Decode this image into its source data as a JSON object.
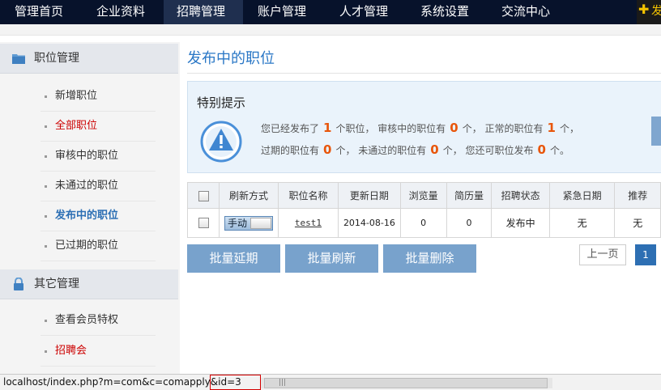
{
  "top_nav": {
    "items": [
      {
        "label": "管理首页",
        "active": false
      },
      {
        "label": "企业资料",
        "active": false
      },
      {
        "label": "招聘管理",
        "active": true
      },
      {
        "label": "账户管理",
        "active": false
      },
      {
        "label": "人才管理",
        "active": false
      },
      {
        "label": "系统设置",
        "active": false
      },
      {
        "label": "交流中心",
        "active": false
      }
    ],
    "publish_label": "发",
    "publish_icon": "plus-icon"
  },
  "sidebar": {
    "groups": [
      {
        "title": "职位管理",
        "icon": "folder-icon",
        "items": [
          {
            "label": "新增职位",
            "style": "normal"
          },
          {
            "label": "全部职位",
            "style": "red"
          },
          {
            "label": "审核中的职位",
            "style": "normal"
          },
          {
            "label": "未通过的职位",
            "style": "normal"
          },
          {
            "label": "发布中的职位",
            "style": "current"
          },
          {
            "label": "已过期的职位",
            "style": "normal"
          }
        ]
      },
      {
        "title": "其它管理",
        "icon": "lock-icon",
        "items": [
          {
            "label": "查看会员特权",
            "style": "normal"
          },
          {
            "label": "招聘会",
            "style": "red"
          }
        ]
      }
    ]
  },
  "main": {
    "title": "发布中的职位",
    "notice": {
      "title": "特别提示",
      "icon": "warning-icon",
      "line1": {
        "t1": "您已经发布了",
        "n1": "1",
        "t2": "个职位，  审核中的职位有",
        "n2": "0",
        "t3": "个，  正常的职位有",
        "n3": "1",
        "t4": "个，"
      },
      "line2": {
        "t1": "过期的职位有",
        "n1": "0",
        "t2": "个，  未通过的职位有",
        "n2": "0",
        "t3": "个，  您还可职位发布",
        "n3": "0",
        "t4": "个。"
      }
    },
    "table": {
      "headers": [
        "",
        "刷新方式",
        "职位名称",
        "更新日期",
        "浏览量",
        "简历量",
        "招聘状态",
        "紧急日期",
        "推荐"
      ],
      "rows": [
        {
          "refresh_mode": "手动",
          "job_name": "test1",
          "updated": "2014-08-16",
          "views": "0",
          "resumes": "0",
          "status": "发布中",
          "urgent_date": "无",
          "recommend": "无"
        }
      ]
    },
    "batch_buttons": [
      "批量延期",
      "批量刷新",
      "批量删除"
    ],
    "pager": {
      "prev": "上一页",
      "current": "1"
    }
  },
  "status_bar": {
    "url": "localhost/index.php?m=com&c=comapply&id=3"
  },
  "colors": {
    "nav_bg": "#07122b",
    "accent_blue": "#2a77c6",
    "number_orange": "#e8560b",
    "button_blue": "#78a2cc",
    "link_red": "#cc0000",
    "publish_yellow": "#f5c400"
  }
}
